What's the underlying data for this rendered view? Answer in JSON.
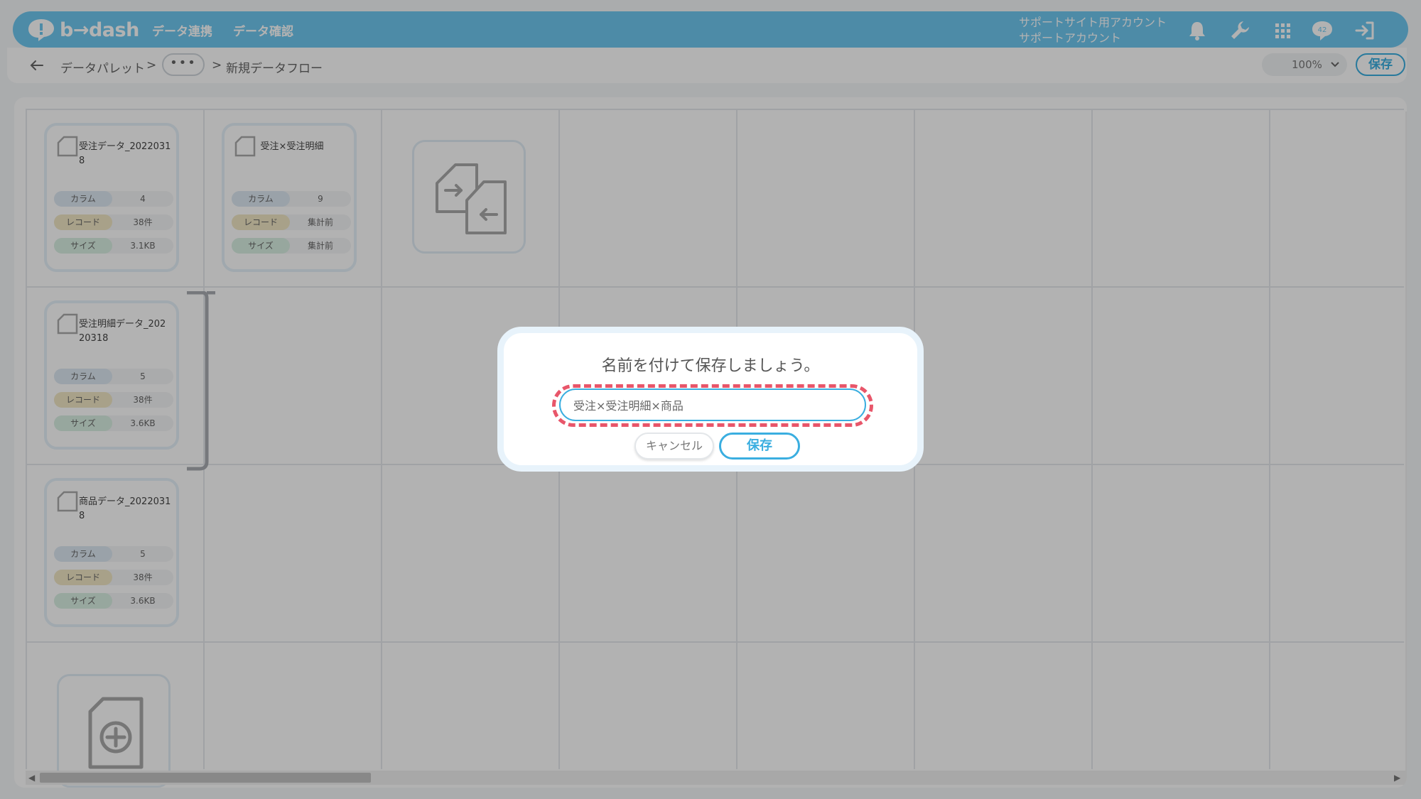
{
  "colors": {
    "brand": "#6fc8ef",
    "accent": "#3aaee0",
    "highlight": "#e8566a"
  },
  "header": {
    "logo_text": "b→dash",
    "nav": [
      "データ連携",
      "データ確認"
    ],
    "account_line1": "サポートサイト用アカウント",
    "account_line2": "サポートアカウント",
    "notification_count": "42",
    "icons": [
      "bell-icon",
      "wrench-icon",
      "grid-icon",
      "chat-icon",
      "logout-icon"
    ]
  },
  "breadcrumb": {
    "root": "データパレット",
    "separator": ">",
    "more": "•••",
    "current": "新規データフロー",
    "zoom": "100%",
    "save_label": "保存"
  },
  "nodes": [
    {
      "title": "受注データ_20220318",
      "stats": [
        {
          "label": "カラム",
          "value": "4"
        },
        {
          "label": "レコード",
          "value": "38件"
        },
        {
          "label": "サイズ",
          "value": "3.1KB"
        }
      ]
    },
    {
      "title": "受注×受注明細",
      "stats": [
        {
          "label": "カラム",
          "value": "9"
        },
        {
          "label": "レコード",
          "value": "集計前"
        },
        {
          "label": "サイズ",
          "value": "集計前"
        }
      ]
    },
    {
      "title": "受注明細データ_20220318",
      "stats": [
        {
          "label": "カラム",
          "value": "5"
        },
        {
          "label": "レコード",
          "value": "38件"
        },
        {
          "label": "サイズ",
          "value": "3.6KB"
        }
      ]
    },
    {
      "title": "商品データ_20220318",
      "stats": [
        {
          "label": "カラム",
          "value": "5"
        },
        {
          "label": "レコード",
          "value": "38件"
        },
        {
          "label": "サイズ",
          "value": "3.6KB"
        }
      ]
    }
  ],
  "modal": {
    "title": "名前を付けて保存しましょう。",
    "input_value": "受注×受注明細×商品",
    "cancel_label": "キャンセル",
    "save_label": "保存"
  }
}
